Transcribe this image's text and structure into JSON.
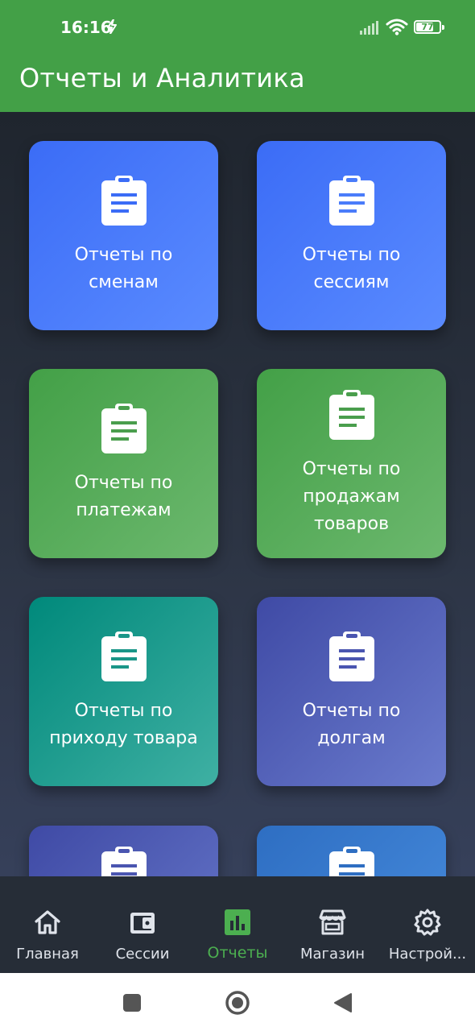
{
  "status_bar": {
    "time": "16:16",
    "battery_level": "77",
    "battery_fraction": 0.77,
    "icons": [
      "bolt-icon",
      "signal-icon",
      "wifi-icon",
      "battery-icon"
    ]
  },
  "app_bar": {
    "title": "Отчеты и Аналитика",
    "color": "#43a047"
  },
  "report_cards": [
    {
      "label": "Отчеты по сменам",
      "icon": "clipboard-icon",
      "color": "#3b6cf6"
    },
    {
      "label": "Отчеты по сессиям",
      "icon": "clipboard-icon",
      "color": "#3b6cf6"
    },
    {
      "label": "Отчеты по платежам",
      "icon": "clipboard-icon",
      "color": "#43a047"
    },
    {
      "label": "Отчеты по продажам товаров",
      "icon": "clipboard-icon",
      "color": "#43a047"
    },
    {
      "label": "Отчеты по приходу товара",
      "icon": "clipboard-icon",
      "color": "#00897b"
    },
    {
      "label": "Отчеты по долгам",
      "icon": "clipboard-icon",
      "color": "#3f4aa5"
    },
    {
      "label": "",
      "icon": "clipboard-icon",
      "color": "#3f4aa5"
    },
    {
      "label": "",
      "icon": "clipboard-icon",
      "color": "#2e6ec2"
    }
  ],
  "bottom_nav": {
    "items": [
      {
        "label": "Главная",
        "icon": "home-icon"
      },
      {
        "label": "Сессии",
        "icon": "wallet-icon"
      },
      {
        "label": "Отчеты",
        "icon": "bar-chart-icon",
        "active": true
      },
      {
        "label": "Магазин",
        "icon": "store-icon"
      },
      {
        "label": "Настрой...",
        "icon": "gear-icon"
      }
    ],
    "active_color": "#4caf50"
  },
  "system_nav": {
    "buttons": [
      "recents-button",
      "home-button",
      "back-button"
    ]
  }
}
